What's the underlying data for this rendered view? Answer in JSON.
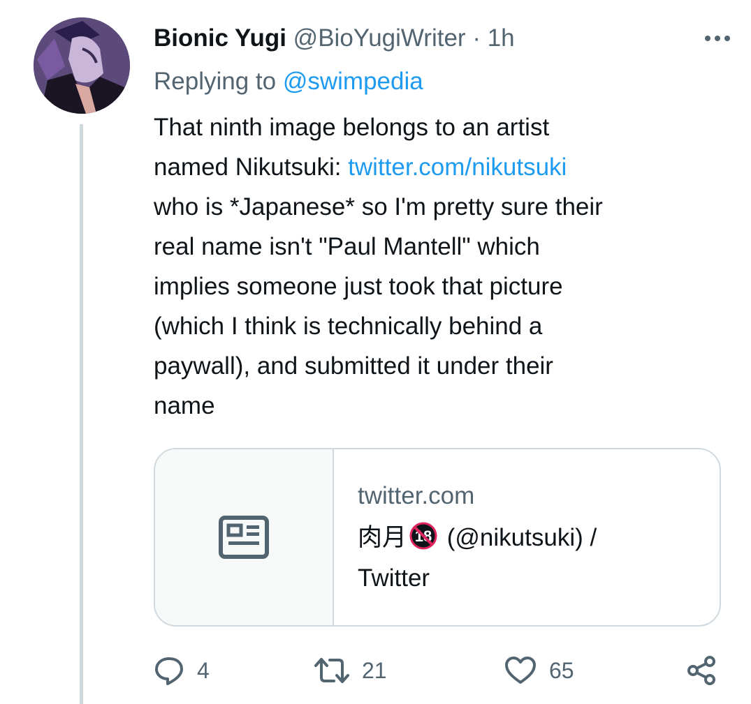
{
  "tweet": {
    "author_name": "Bionic Yugi",
    "author_handle": "@BioYugiWriter",
    "separator": "·",
    "time": "1h",
    "replying_prefix": "Replying to",
    "replying_to": "@swimpedia",
    "text_lines": [
      "That ninth image belongs to an artist",
      "named Nikutsuki: ",
      "who is *Japanese* so I'm pretty sure their",
      "real name isn't \"Paul Mantell\" which",
      "implies someone just took that picture",
      "(which I think is technically behind a",
      "paywall), and submitted it under their",
      "name"
    ],
    "inline_link": "twitter.com/nikutsuki"
  },
  "card": {
    "domain": "twitter.com",
    "title_prefix": "肉月",
    "badge_text": "18",
    "title_suffix": " (@nikutsuki) /",
    "title_line2": "Twitter",
    "thumb_icon": "newspaper-icon"
  },
  "actions": {
    "reply_count": "4",
    "retweet_count": "21",
    "like_count": "65"
  },
  "colors": {
    "link": "#1d9bf0",
    "secondary_text": "#536471",
    "border": "#cfd9de"
  }
}
